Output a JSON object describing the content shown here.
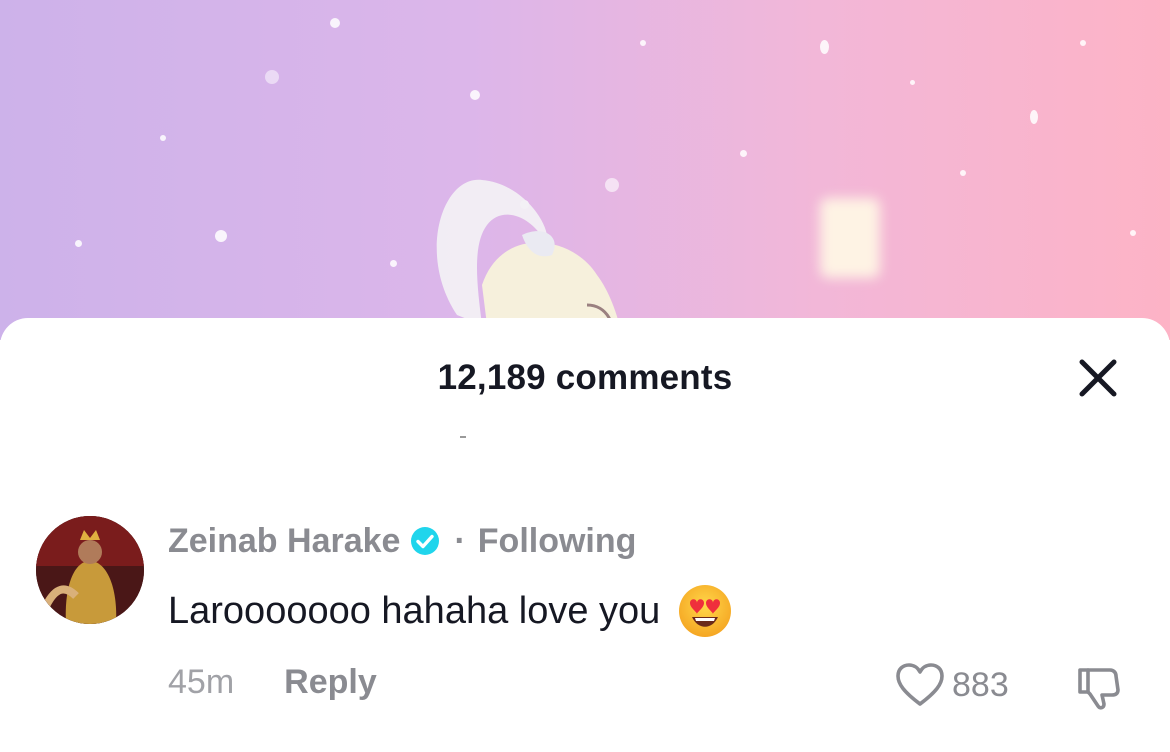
{
  "header": {
    "title": "12,189 comments",
    "close_icon": "close-icon"
  },
  "comment": {
    "username": "Zeinab Harake",
    "verified": true,
    "separator": "·",
    "relation": "Following",
    "text": "Larooooooo hahaha love you",
    "emoji": "heart-eyes-emoji",
    "time": "45m",
    "reply_label": "Reply",
    "like_count": "883"
  },
  "colors": {
    "title": "#161823",
    "muted": "#8a8b91",
    "verified": "#20d5ec",
    "background_gradient": [
      "#cdb2ea",
      "#fdb3c6"
    ]
  }
}
